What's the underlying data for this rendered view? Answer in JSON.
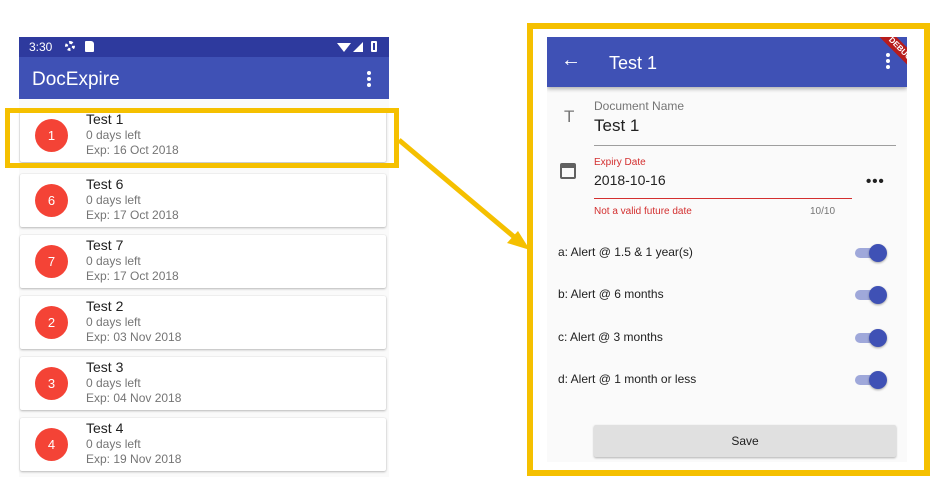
{
  "left": {
    "status_bar": {
      "time": "3:30"
    },
    "app_title": "DocExpire",
    "documents": [
      {
        "badge": "1",
        "title": "Test 1",
        "days_left": "0 days left",
        "expiry": "Exp: 16 Oct 2018"
      },
      {
        "badge": "6",
        "title": "Test 6",
        "days_left": "0 days left",
        "expiry": "Exp: 17 Oct 2018"
      },
      {
        "badge": "7",
        "title": "Test 7",
        "days_left": "0 days left",
        "expiry": "Exp: 17 Oct 2018"
      },
      {
        "badge": "2",
        "title": "Test 2",
        "days_left": "0 days left",
        "expiry": "Exp: 03 Nov 2018"
      },
      {
        "badge": "3",
        "title": "Test 3",
        "days_left": "0 days left",
        "expiry": "Exp: 04 Nov 2018"
      },
      {
        "badge": "4",
        "title": "Test 4",
        "days_left": "0 days left",
        "expiry": "Exp: 19 Nov 2018"
      }
    ]
  },
  "right": {
    "app_title": "Test 1",
    "debug_banner": "DEBUG",
    "document_name": {
      "label": "Document Name",
      "value": "Test 1"
    },
    "expiry_date": {
      "label": "Expiry Date",
      "value": "2018-10-16",
      "more": "•••",
      "error": "Not a valid future date",
      "counter": "10/10"
    },
    "alerts": [
      {
        "label": "a: Alert @ 1.5 & 1 year(s)",
        "enabled": true
      },
      {
        "label": "b: Alert @ 6 months",
        "enabled": true
      },
      {
        "label": "c: Alert @ 3 months",
        "enabled": true
      },
      {
        "label": "d: Alert @ 1 month or less",
        "enabled": true
      }
    ],
    "save_label": "Save"
  },
  "colors": {
    "primary": "#3f51b5",
    "status_bar": "#2e3a9e",
    "avatar": "#f44336",
    "highlight": "#f5c000",
    "error": "#d32f2f"
  },
  "icons": {
    "status": [
      "settings-gear-icon",
      "sd-card-icon",
      "wifi-icon",
      "signal-icon",
      "battery-icon"
    ],
    "app": [
      "overflow-menu-icon",
      "back-arrow-icon",
      "text-field-icon",
      "calendar-icon"
    ]
  }
}
